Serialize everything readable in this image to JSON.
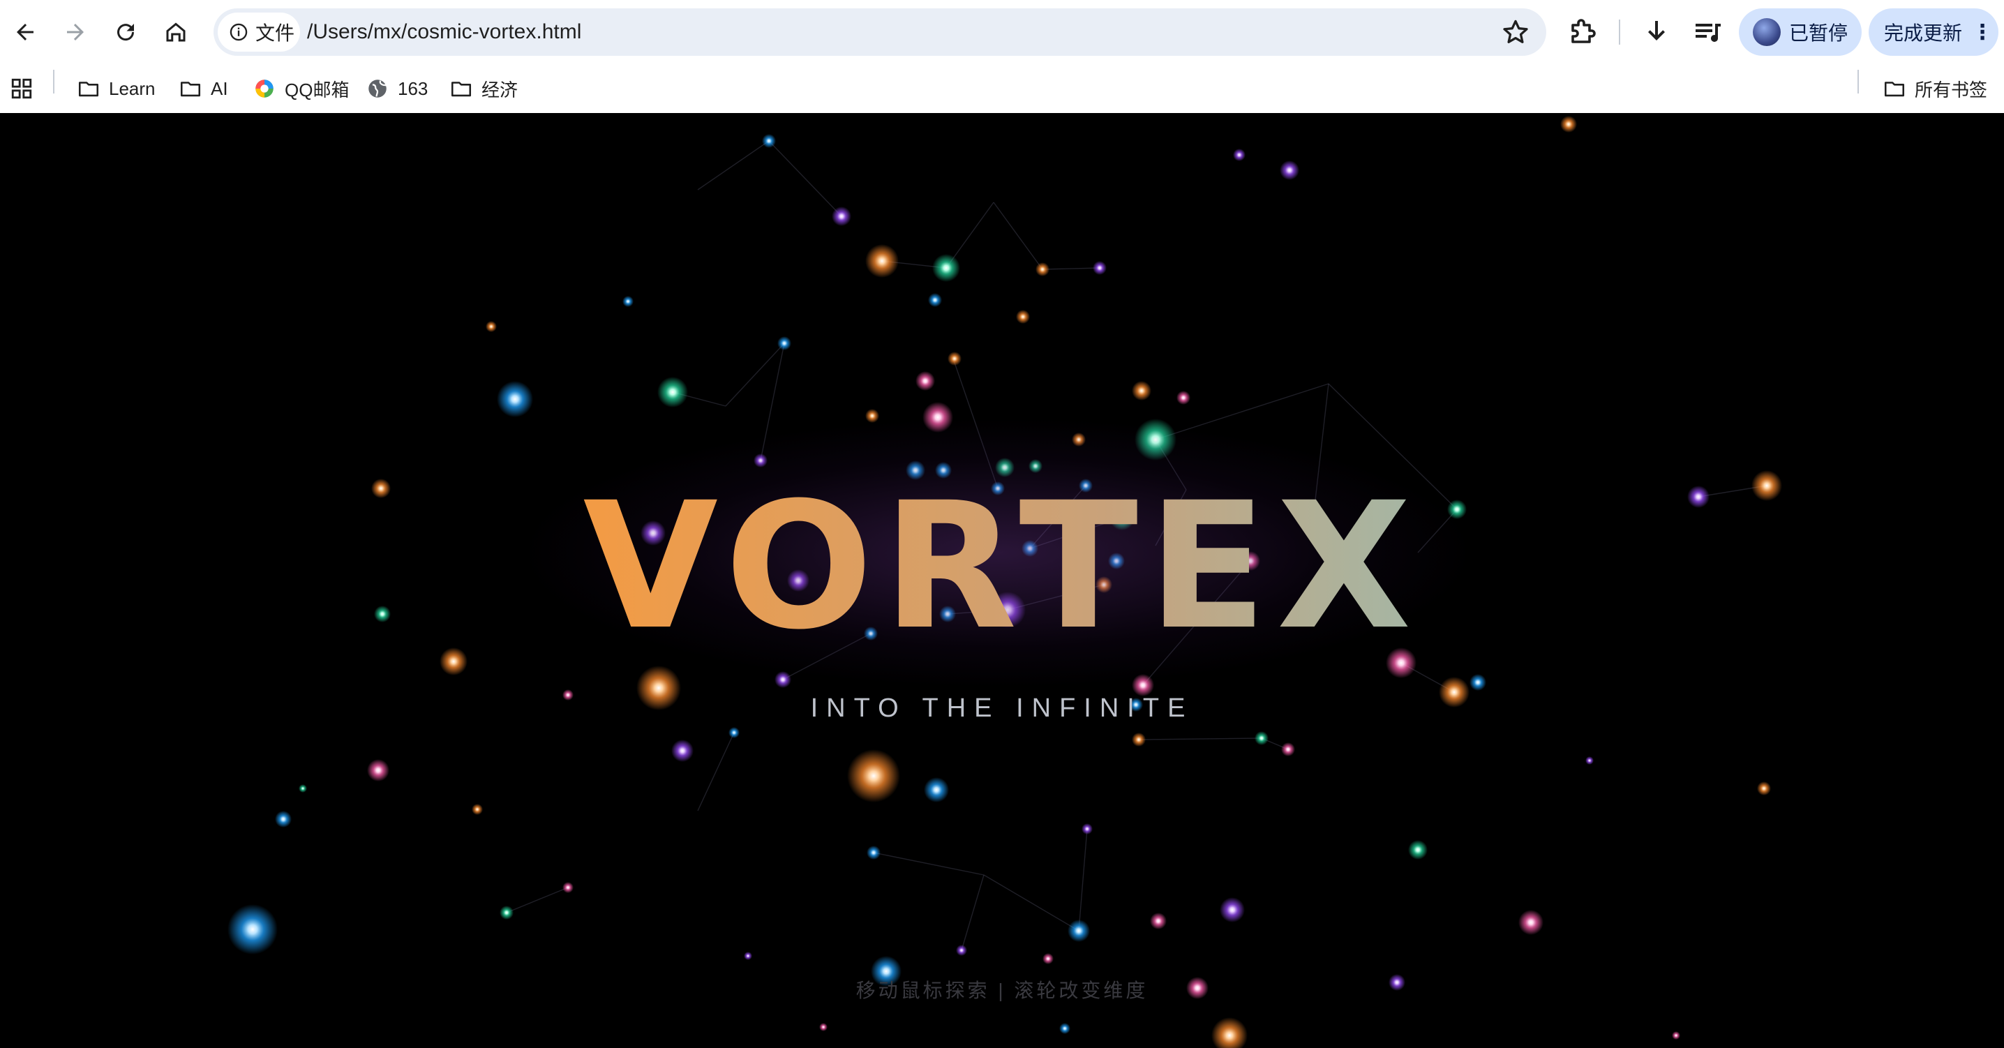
{
  "browser": {
    "site_label": "文件",
    "url": "/Users/mx/cosmic-vortex.html",
    "profile_label": "已暂停",
    "update_label": "完成更新"
  },
  "bookmarks": {
    "items": [
      {
        "label": "Learn",
        "icon": "folder-icon"
      },
      {
        "label": "AI",
        "icon": "folder-icon"
      },
      {
        "label": "QQ邮箱",
        "icon": "qq-mail-icon"
      },
      {
        "label": "163",
        "icon": "globe-icon"
      },
      {
        "label": "经济",
        "icon": "folder-icon"
      }
    ],
    "all_bookmarks_label": "所有书签"
  },
  "page": {
    "title": "VORTEX",
    "subtitle": "INTO THE INFINITE",
    "hint": "移动鼠标探索 | 滚轮改变维度",
    "background": "#000000",
    "title_gradient": [
      "#ff9a3c",
      "#c9a27a",
      "#7ec4d8"
    ],
    "particle_colors": [
      "#ff9a3c",
      "#2ee6a6",
      "#2aa8ff",
      "#a35cff",
      "#ff6fb5"
    ]
  }
}
